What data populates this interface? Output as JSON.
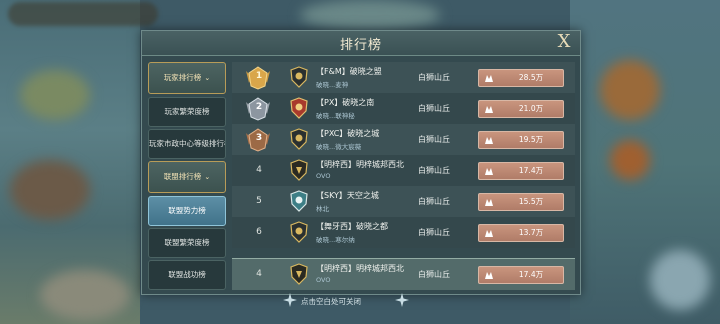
{
  "dialog": {
    "title": "排行榜",
    "close_label": "X"
  },
  "sidebar": {
    "groups": [
      {
        "label": "玩家排行榜",
        "chevron": "⌄"
      },
      {
        "label": "联盟排行榜",
        "chevron": "⌄"
      }
    ],
    "items": [
      {
        "label": "玩家繁荣度榜"
      },
      {
        "label": "玩家市政中心等级排行榜"
      },
      {
        "label": "联盟势力榜"
      },
      {
        "label": "联盟繁荣度榜"
      },
      {
        "label": "联盟战功榜"
      }
    ]
  },
  "rankings": [
    {
      "rank": "1",
      "medal": "gold-medal-icon",
      "guild": "【F&M】破晓之盟",
      "leader": "破晓...麦神",
      "location": "白狮山丘",
      "power": "28.5万"
    },
    {
      "rank": "2",
      "medal": "silver-medal-icon",
      "guild": "【PX】破晓之南",
      "leader": "破晓...联神秘",
      "location": "白狮山丘",
      "power": "21.0万"
    },
    {
      "rank": "3",
      "medal": "bronze-medal-icon",
      "guild": "【PXC】破晓之城",
      "leader": "破晓...微大宸薇",
      "location": "白狮山丘",
      "power": "19.5万"
    },
    {
      "rank": "4",
      "medal": "",
      "guild": "【明梓西】明梓城邦西北",
      "leader": "OVO",
      "location": "白狮山丘",
      "power": "17.4万"
    },
    {
      "rank": "5",
      "medal": "",
      "guild": "【SKY】天空之城",
      "leader": "林北",
      "location": "白狮山丘",
      "power": "15.5万"
    },
    {
      "rank": "6",
      "medal": "",
      "guild": "【舞牙西】破晓之都",
      "leader": "破晓...寒尔纳",
      "location": "白狮山丘",
      "power": "13.7万"
    }
  ],
  "self_row": {
    "rank": "4",
    "guild": "【明梓西】明梓城邦西北",
    "leader": "OVO",
    "location": "白狮山丘",
    "power": "17.4万"
  },
  "footer": {
    "hint": "点击空白处可关闭"
  },
  "colors": {
    "gold": "#d9a64a",
    "silver": "#b8c0c8",
    "bronze": "#b57a4c",
    "power_bg": "#b98670",
    "active_tab": "#4f84a0"
  }
}
